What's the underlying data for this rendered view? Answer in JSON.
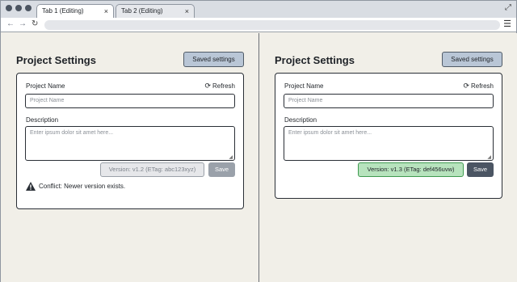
{
  "browser": {
    "tabs": [
      {
        "label": "Tab 1 (Editing)",
        "close": "×"
      },
      {
        "label": "Tab 2 (Editing)",
        "close": "×"
      }
    ],
    "icons": {
      "back": "←",
      "forward": "→",
      "reload": "↻",
      "menu": "☰",
      "expand": "⤢"
    }
  },
  "left": {
    "title": "Project Settings",
    "saved_button": "Saved settings",
    "project_name_label": "Project Name",
    "refresh_label": "Refresh",
    "project_name_placeholder": "Project Name",
    "description_label": "Description",
    "description_placeholder": "Enter ipsum dolor sit amet here...",
    "version": "Version: v1.2 (ETag: abc123xyz)",
    "save_label": "Save",
    "conflict_message": "Conflict: Newer version exists."
  },
  "right": {
    "title": "Project Settings",
    "saved_button": "Saved settings",
    "project_name_label": "Project Name",
    "refresh_label": "Refresh",
    "project_name_placeholder": "Project Name",
    "description_label": "Description",
    "description_placeholder": "Enter ipsum dolor sit amet here...",
    "version": "Version: v1.3 (ETag: def456uvw)",
    "save_label": "Save"
  },
  "colors": {
    "stale_version_bg": "#e6e7ea",
    "fresh_version_bg": "#b7e3bd",
    "save_disabled": "#9aa1aa",
    "save_enabled": "#4b5563",
    "saved_button_bg": "#b9c6d6"
  }
}
